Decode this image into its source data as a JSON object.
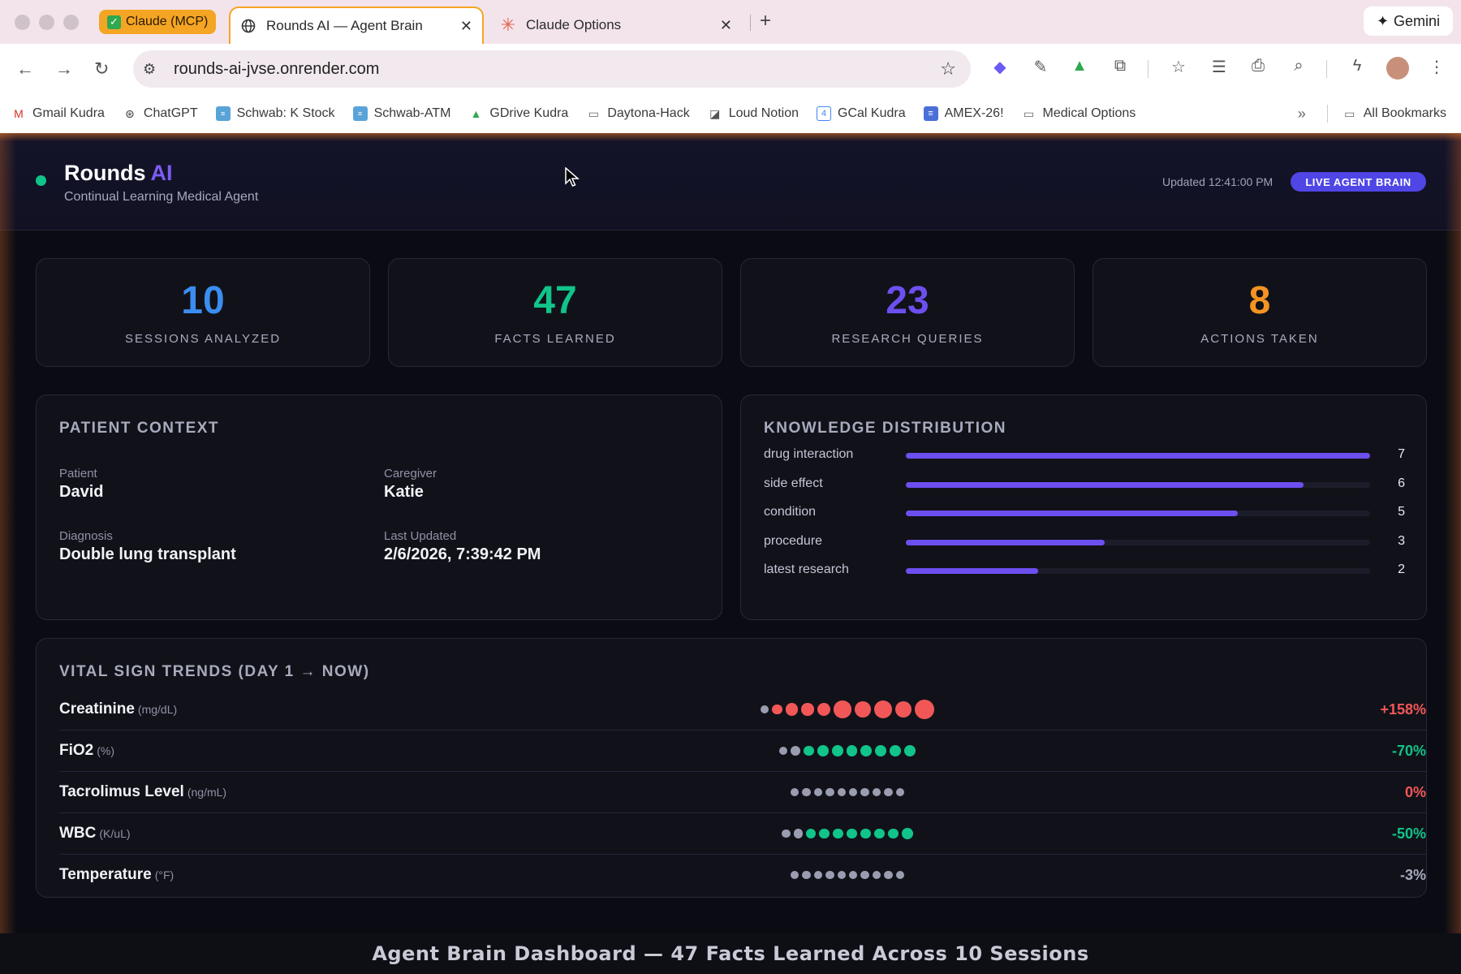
{
  "browser": {
    "pinned_tab_label": "Claude (MCP)",
    "tabs": [
      {
        "label": "Rounds AI — Agent Brain",
        "active": true
      },
      {
        "label": "Claude Options",
        "active": false
      }
    ],
    "gemini_label": "Gemini",
    "url": "rounds-ai-jvse.onrender.com",
    "bookmarks": [
      {
        "label": "Gmail Kudra",
        "icon": "gmail-icon"
      },
      {
        "label": "ChatGPT",
        "icon": "chatgpt-icon"
      },
      {
        "label": "Schwab: K Stock",
        "icon": "schwab-icon"
      },
      {
        "label": "Schwab-ATM",
        "icon": "schwab-icon"
      },
      {
        "label": "GDrive Kudra",
        "icon": "drive-icon"
      },
      {
        "label": "Daytona-Hack",
        "icon": "folder-icon"
      },
      {
        "label": "Loud Notion",
        "icon": "notion-icon"
      },
      {
        "label": "GCal Kudra",
        "icon": "calendar-icon"
      },
      {
        "label": "AMEX-26!",
        "icon": "doc-icon"
      },
      {
        "label": "Medical Options",
        "icon": "folder-icon"
      }
    ],
    "all_bookmarks_label": "All Bookmarks"
  },
  "header": {
    "brand": "Rounds",
    "brand_accent": "AI",
    "subtitle": "Continual Learning Medical Agent",
    "updated": "Updated 12:41:00 PM",
    "live_badge": "LIVE AGENT BRAIN"
  },
  "stats": [
    {
      "value": "10",
      "label": "SESSIONS ANALYZED",
      "color": "#3b8df0"
    },
    {
      "value": "47",
      "label": "FACTS LEARNED",
      "color": "#10c48a"
    },
    {
      "value": "23",
      "label": "RESEARCH QUERIES",
      "color": "#6d4ff0"
    },
    {
      "value": "8",
      "label": "ACTIONS TAKEN",
      "color": "#f59322"
    }
  ],
  "patient_context": {
    "title": "PATIENT CONTEXT",
    "fields": [
      {
        "label": "Patient",
        "value": "David"
      },
      {
        "label": "Caregiver",
        "value": "Katie"
      },
      {
        "label": "Diagnosis",
        "value": "Double lung transplant"
      },
      {
        "label": "Last Updated",
        "value": "2/6/2026, 7:39:42 PM"
      }
    ]
  },
  "knowledge_distribution": {
    "title": "KNOWLEDGE DISTRIBUTION",
    "max": 7,
    "items": [
      {
        "label": "drug interaction",
        "count": 7
      },
      {
        "label": "side effect",
        "count": 6
      },
      {
        "label": "condition",
        "count": 5
      },
      {
        "label": "procedure",
        "count": 3
      },
      {
        "label": "latest research",
        "count": 2
      }
    ]
  },
  "vital_trends": {
    "title": "VITAL SIGN TRENDS (DAY 1 → NOW)",
    "rows": [
      {
        "name": "Creatinine",
        "unit": "(mg/dL)",
        "change": "+158%",
        "change_color": "#f25757",
        "dots": [
          [
            "#9a9cb0",
            0.2
          ],
          [
            "#f25757",
            0.35
          ],
          [
            "#f25757",
            0.5
          ],
          [
            "#f25757",
            0.5
          ],
          [
            "#f25757",
            0.55
          ],
          [
            "#f25757",
            0.85
          ],
          [
            "#f25757",
            0.75
          ],
          [
            "#f25757",
            0.9
          ],
          [
            "#f25757",
            0.8
          ],
          [
            "#f25757",
            1.0
          ]
        ]
      },
      {
        "name": "FiO2",
        "unit": "(%)",
        "change": "-70%",
        "change_color": "#10c48a",
        "dots": [
          [
            "#9a9cb0",
            0.2
          ],
          [
            "#9a9cb0",
            0.3
          ],
          [
            "#10c48a",
            0.35
          ],
          [
            "#10c48a",
            0.4
          ],
          [
            "#10c48a",
            0.4
          ],
          [
            "#10c48a",
            0.4
          ],
          [
            "#10c48a",
            0.4
          ],
          [
            "#10c48a",
            0.4
          ],
          [
            "#10c48a",
            0.4
          ],
          [
            "#10c48a",
            0.45
          ]
        ]
      },
      {
        "name": "Tacrolimus Level",
        "unit": "(ng/mL)",
        "change": "0%",
        "change_color": "#f25757",
        "dots": [
          [
            "#9a9cb0",
            0.2
          ],
          [
            "#9a9cb0",
            0.2
          ],
          [
            "#9a9cb0",
            0.2
          ],
          [
            "#9a9cb0",
            0.2
          ],
          [
            "#9a9cb0",
            0.2
          ],
          [
            "#9a9cb0",
            0.2
          ],
          [
            "#9a9cb0",
            0.2
          ],
          [
            "#9a9cb0",
            0.2
          ],
          [
            "#9a9cb0",
            0.2
          ],
          [
            "#9a9cb0",
            0.2
          ]
        ]
      },
      {
        "name": "WBC",
        "unit": "(K/uL)",
        "change": "-50%",
        "change_color": "#10c48a",
        "dots": [
          [
            "#9a9cb0",
            0.2
          ],
          [
            "#9a9cb0",
            0.25
          ],
          [
            "#10c48a",
            0.3
          ],
          [
            "#10c48a",
            0.35
          ],
          [
            "#10c48a",
            0.35
          ],
          [
            "#10c48a",
            0.35
          ],
          [
            "#10c48a",
            0.35
          ],
          [
            "#10c48a",
            0.35
          ],
          [
            "#10c48a",
            0.35
          ],
          [
            "#10c48a",
            0.4
          ]
        ]
      },
      {
        "name": "Temperature",
        "unit": "(°F)",
        "change": "-3%",
        "change_color": "#a8abbe",
        "dots": [
          [
            "#9a9cb0",
            0.2
          ],
          [
            "#9a9cb0",
            0.2
          ],
          [
            "#9a9cb0",
            0.2
          ],
          [
            "#9a9cb0",
            0.2
          ],
          [
            "#9a9cb0",
            0.2
          ],
          [
            "#9a9cb0",
            0.2
          ],
          [
            "#9a9cb0",
            0.2
          ],
          [
            "#9a9cb0",
            0.2
          ],
          [
            "#9a9cb0",
            0.2
          ],
          [
            "#9a9cb0",
            0.2
          ]
        ]
      }
    ]
  },
  "caption": "Agent Brain Dashboard — 47 Facts Learned Across 10 Sessions"
}
